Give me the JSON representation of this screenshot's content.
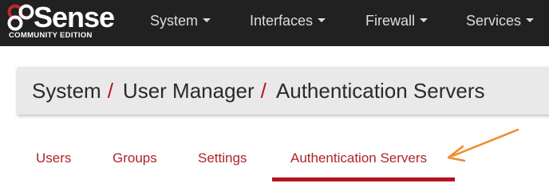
{
  "app": {
    "logo_text": "Sense",
    "logo_edition": "COMMUNITY EDITION"
  },
  "nav": {
    "items": [
      {
        "label": "System"
      },
      {
        "label": "Interfaces"
      },
      {
        "label": "Firewall"
      },
      {
        "label": "Services"
      }
    ]
  },
  "breadcrumb": {
    "parts": [
      "System",
      "User Manager",
      "Authentication Servers"
    ],
    "separator": "/"
  },
  "tabs": [
    {
      "label": "Users"
    },
    {
      "label": "Groups"
    },
    {
      "label": "Settings"
    },
    {
      "label": "Authentication Servers",
      "active": true
    }
  ],
  "colors": {
    "navbar_bg": "#212121",
    "accent_red": "#b5121b",
    "annotation_arrow": "#f08a2c"
  }
}
